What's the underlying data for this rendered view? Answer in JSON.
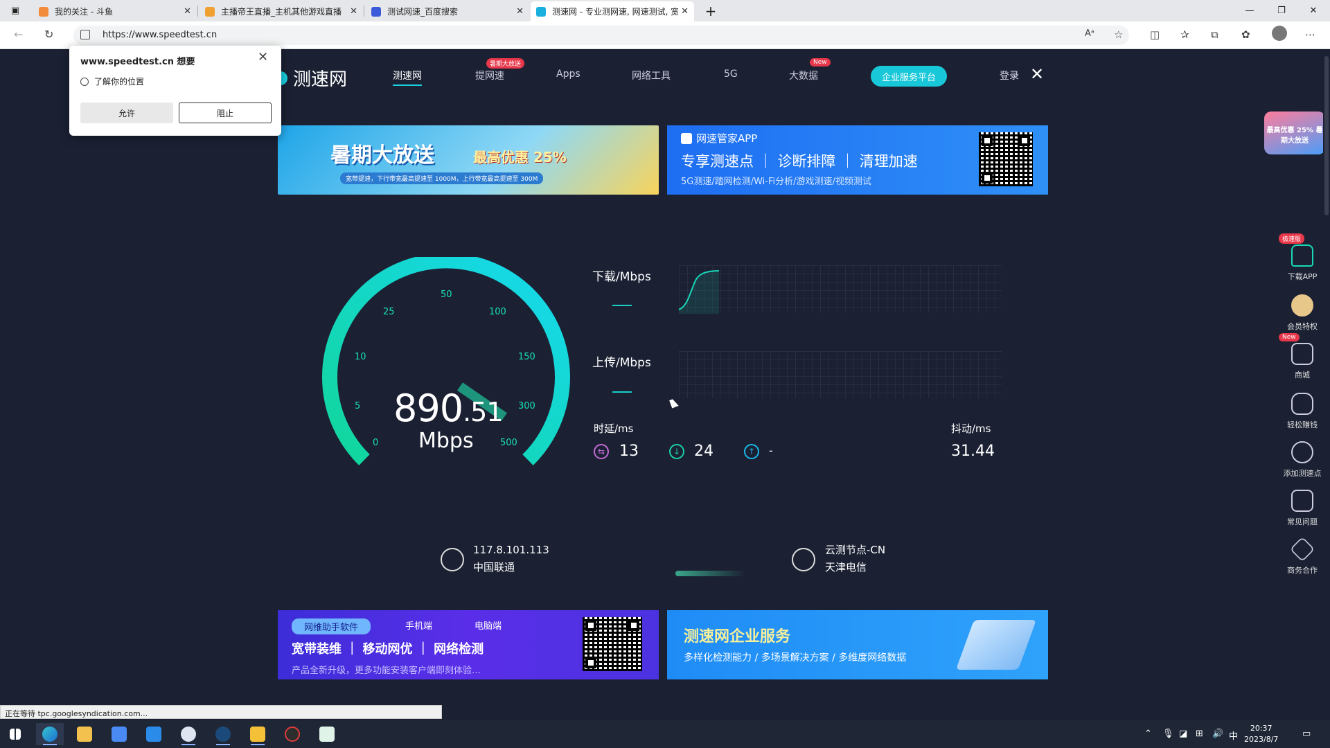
{
  "browser": {
    "tabs": [
      {
        "label": "我的关注 - 斗鱼",
        "favicon_color": "#f28b3b"
      },
      {
        "label": "主播帝王直播_主机其他游戏直播",
        "favicon_color": "#f0a030"
      },
      {
        "label": "测试网速_百度搜索",
        "favicon_color": "#3a5bd9"
      },
      {
        "label": "测速网 - 专业测网速, 网速测试, 宽",
        "favicon_color": "#19b0e0"
      }
    ],
    "new_tab_label": "+",
    "url": "https://www.speedtest.cn",
    "window": {
      "minimize": "—",
      "restore": "❐",
      "close": "✕"
    }
  },
  "permission_popup": {
    "title": "www.speedtest.cn 想要",
    "request": "了解你的位置",
    "allow_label": "允许",
    "block_label": "阻止",
    "close": "✕"
  },
  "site_nav": {
    "logo": "测速网",
    "items": [
      {
        "label": "测速网",
        "active": true
      },
      {
        "label": "提网速",
        "badge": "暑期大放送"
      },
      {
        "label": "Apps"
      },
      {
        "label": "网络工具"
      },
      {
        "label": "5G"
      },
      {
        "label": "大数据",
        "badge": "New"
      }
    ],
    "enterprise_label": "企业服务平台",
    "login_label": "登录",
    "close": "✕"
  },
  "banners": {
    "summer": {
      "title": "暑期大放送",
      "offer": "最高优惠 25%",
      "sub": "宽带提速，下行带宽最高提速至 1000M，上行带宽最高提速至 300M"
    },
    "app": {
      "header": "网速管家APP",
      "main": "专享测速点 ｜ 诊断排障 ｜ 清理加速",
      "sub": "5G测速/踏网检测/Wi-Fi分析/游戏测速/视频测试"
    },
    "assistant": {
      "pill": "网维助手软件",
      "opt1": "手机端",
      "opt2": "电脑端",
      "main": "宽带装维 ｜ 移动网优 ｜ 网络检测",
      "sub": "产品全新升级，更多功能安装客户端即刻体验…"
    },
    "enterprise": {
      "main": "测速网企业服务",
      "sub": "多样化检测能力 / 多场景解决方案 / 多维度网络数据"
    }
  },
  "gauge": {
    "speed_int": "890",
    "speed_dec": ".51",
    "unit": "Mbps",
    "scale": [
      "0",
      "5",
      "10",
      "25",
      "50",
      "100",
      "150",
      "300",
      "500"
    ]
  },
  "charts": {
    "download_label": "下载/Mbps",
    "upload_label": "上传/Mbps"
  },
  "stats": {
    "latency_label": "时延/ms",
    "jitter_label": "抖动/ms",
    "ping": "13",
    "download_latency": "24",
    "upload_latency": "-",
    "jitter": "31.44"
  },
  "client": {
    "ip": "117.8.101.113",
    "isp": "中国联通"
  },
  "server": {
    "name": "云测节点-CN",
    "isp": "天津电信"
  },
  "sidebar": {
    "promo": "最高优惠 25% 暑期大放送",
    "items": [
      {
        "label": "下载APP",
        "badge": "极速版"
      },
      {
        "label": "会员特权"
      },
      {
        "label": "商城",
        "badge": "New"
      },
      {
        "label": "轻松赚钱"
      },
      {
        "label": "添加测速点"
      },
      {
        "label": "常见问题"
      },
      {
        "label": "商务合作"
      }
    ]
  },
  "status_bar": "正在等待 tpc.googlesyndication.com...",
  "taskbar": {
    "time": "20:37",
    "date": "2023/8/7",
    "ime": "中"
  }
}
